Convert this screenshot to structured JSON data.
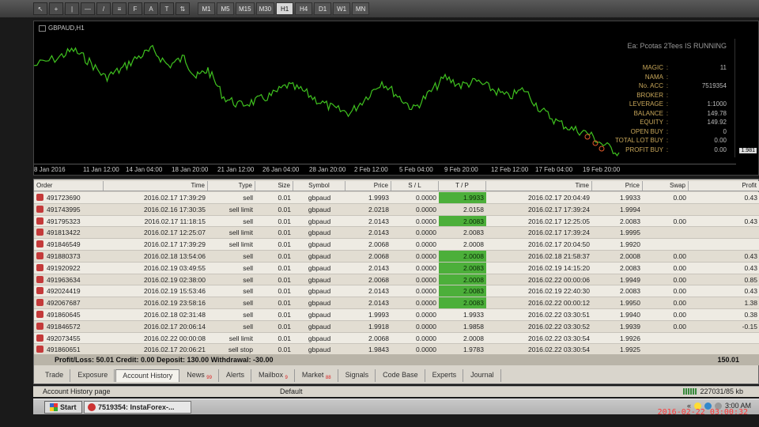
{
  "toolbar": {
    "timeframes": [
      "M1",
      "M5",
      "M15",
      "M30",
      "H1",
      "H4",
      "D1",
      "W1",
      "MN"
    ],
    "active_timeframe": "H1"
  },
  "chart": {
    "title": "GBPAUD,H1",
    "ea_status": "Ea: Pcotas  2Tees  IS  RUNNING",
    "info": [
      {
        "k": "MAGIC",
        "v": "11"
      },
      {
        "k": "NAMA",
        "v": ""
      },
      {
        "k": "No. ACC",
        "v": "7519354"
      },
      {
        "k": "BROKER",
        "v": ""
      },
      {
        "k": "LEVERAGE",
        "v": "1:1000"
      },
      {
        "k": "BALANCE",
        "v": "149.78"
      },
      {
        "k": "EQUITY",
        "v": "149.92"
      },
      {
        "k": "OPEN BUY",
        "v": "0"
      },
      {
        "k": "TOTAL LOT BUY",
        "v": "0.00"
      },
      {
        "k": "PROFIT BUY",
        "v": "0.00"
      }
    ],
    "price_tag": "1.981",
    "time_labels": [
      "8 Jan 2016",
      "11 Jan 12:00",
      "14 Jan 04:00",
      "18 Jan 20:00",
      "21 Jan 12:00",
      "26 Jan 04:00",
      "28 Jan 20:00",
      "2 Feb 12:00",
      "5 Feb 04:00",
      "9 Feb 20:00",
      "12 Feb 12:00",
      "17 Feb 04:00",
      "19 Feb 20:00"
    ]
  },
  "table": {
    "headers": [
      "Order",
      "Time",
      "Type",
      "Size",
      "Symbol",
      "Price",
      "S / L",
      "T / P",
      "Time",
      "Price",
      "Swap",
      "Profit"
    ],
    "rows": [
      {
        "order": "491723690",
        "time": "2016.02.17 17:39:29",
        "type": "sell",
        "size": "0.01",
        "symbol": "gbpaud",
        "price": "1.9993",
        "sl": "0.0000",
        "tp": "1.9933",
        "tp_hl": true,
        "time2": "2016.02.17 20:04:49",
        "price2": "1.9933",
        "swap": "0.00",
        "profit": "0.43"
      },
      {
        "order": "491743995",
        "time": "2016.02.16 17:30:35",
        "type": "sell limit",
        "size": "0.01",
        "symbol": "gbpaud",
        "price": "2.0218",
        "sl": "0.0000",
        "tp": "2.0158",
        "tp_hl": false,
        "time2": "2016.02.17 17:39:24",
        "price2": "1.9994",
        "swap": "",
        "profit": ""
      },
      {
        "order": "491795323",
        "time": "2016.02.17 11:18:15",
        "type": "sell",
        "size": "0.01",
        "symbol": "gbpaud",
        "price": "2.0143",
        "sl": "0.0000",
        "tp": "2.0083",
        "tp_hl": true,
        "time2": "2016.02.17 12:25:05",
        "price2": "2.0083",
        "swap": "0.00",
        "profit": "0.43"
      },
      {
        "order": "491813422",
        "time": "2016.02.17 12:25:07",
        "type": "sell limit",
        "size": "0.01",
        "symbol": "gbpaud",
        "price": "2.0143",
        "sl": "0.0000",
        "tp": "2.0083",
        "tp_hl": false,
        "time2": "2016.02.17 17:39:24",
        "price2": "1.9995",
        "swap": "",
        "profit": ""
      },
      {
        "order": "491846549",
        "time": "2016.02.17 17:39:29",
        "type": "sell limit",
        "size": "0.01",
        "symbol": "gbpaud",
        "price": "2.0068",
        "sl": "0.0000",
        "tp": "2.0008",
        "tp_hl": false,
        "time2": "2016.02.17 20:04:50",
        "price2": "1.9920",
        "swap": "",
        "profit": ""
      },
      {
        "order": "491880373",
        "time": "2016.02.18 13:54:06",
        "type": "sell",
        "size": "0.01",
        "symbol": "gbpaud",
        "price": "2.0068",
        "sl": "0.0000",
        "tp": "2.0008",
        "tp_hl": true,
        "time2": "2016.02.18 21:58:37",
        "price2": "2.0008",
        "swap": "0.00",
        "profit": "0.43"
      },
      {
        "order": "491920922",
        "time": "2016.02.19 03:49:55",
        "type": "sell",
        "size": "0.01",
        "symbol": "gbpaud",
        "price": "2.0143",
        "sl": "0.0000",
        "tp": "2.0083",
        "tp_hl": true,
        "time2": "2016.02.19 14:15:20",
        "price2": "2.0083",
        "swap": "0.00",
        "profit": "0.43"
      },
      {
        "order": "491963634",
        "time": "2016.02.19 02:38:00",
        "type": "sell",
        "size": "0.01",
        "symbol": "gbpaud",
        "price": "2.0068",
        "sl": "0.0000",
        "tp": "2.0008",
        "tp_hl": true,
        "time2": "2016.02.22 00:00:06",
        "price2": "1.9949",
        "swap": "0.00",
        "profit": "0.85"
      },
      {
        "order": "492024419",
        "time": "2016.02.19 15:53:46",
        "type": "sell",
        "size": "0.01",
        "symbol": "gbpaud",
        "price": "2.0143",
        "sl": "0.0000",
        "tp": "2.0083",
        "tp_hl": true,
        "time2": "2016.02.19 22:40:30",
        "price2": "2.0083",
        "swap": "0.00",
        "profit": "0.43"
      },
      {
        "order": "492067687",
        "time": "2016.02.19 23:58:16",
        "type": "sell",
        "size": "0.01",
        "symbol": "gbpaud",
        "price": "2.0143",
        "sl": "0.0000",
        "tp": "2.0083",
        "tp_hl": true,
        "time2": "2016.02.22 00:00:12",
        "price2": "1.9950",
        "swap": "0.00",
        "profit": "1.38"
      },
      {
        "order": "491860645",
        "time": "2016.02.18 02:31:48",
        "type": "sell",
        "size": "0.01",
        "symbol": "gbpaud",
        "price": "1.9993",
        "sl": "0.0000",
        "tp": "1.9933",
        "tp_hl": false,
        "time2": "2016.02.22 03:30:51",
        "price2": "1.9940",
        "swap": "0.00",
        "profit": "0.38"
      },
      {
        "order": "491846572",
        "time": "2016.02.17 20:06:14",
        "type": "sell",
        "size": "0.01",
        "symbol": "gbpaud",
        "price": "1.9918",
        "sl": "0.0000",
        "tp": "1.9858",
        "tp_hl": false,
        "time2": "2016.02.22 03:30:52",
        "price2": "1.9939",
        "swap": "0.00",
        "profit": "-0.15"
      },
      {
        "order": "492073455",
        "time": "2016.02.22 00:00:08",
        "type": "sell limit",
        "size": "0.01",
        "symbol": "gbpaud",
        "price": "2.0068",
        "sl": "0.0000",
        "tp": "2.0008",
        "tp_hl": false,
        "time2": "2016.02.22 03:30:54",
        "price2": "1.9926",
        "swap": "",
        "profit": ""
      },
      {
        "order": "491860651",
        "time": "2016.02.17 20:06:21",
        "type": "sell stop",
        "size": "0.01",
        "symbol": "gbpaud",
        "price": "1.9843",
        "sl": "0.0000",
        "tp": "1.9783",
        "tp_hl": false,
        "time2": "2016.02.22 03:30:54",
        "price2": "1.9925",
        "swap": "",
        "profit": ""
      }
    ]
  },
  "summary": {
    "text": "Profit/Loss: 50.01  Credit: 0.00  Deposit: 130.00  Withdrawal: -30.00",
    "total": "150.01"
  },
  "tabs": [
    {
      "label": "Trade",
      "badge": ""
    },
    {
      "label": "Exposure",
      "badge": ""
    },
    {
      "label": "Account History",
      "badge": "",
      "active": true
    },
    {
      "label": "News",
      "badge": "99"
    },
    {
      "label": "Alerts",
      "badge": ""
    },
    {
      "label": "Mailbox",
      "badge": "9"
    },
    {
      "label": "Market",
      "badge": "88"
    },
    {
      "label": "Signals",
      "badge": ""
    },
    {
      "label": "Code Base",
      "badge": ""
    },
    {
      "label": "Experts",
      "badge": ""
    },
    {
      "label": "Journal",
      "badge": ""
    }
  ],
  "statusbar": {
    "left": "Account History page",
    "mid": "Default",
    "right": "227031/85 kb"
  },
  "taskbar": {
    "start": "Start",
    "task": "7519354: InstaForex-...",
    "clock": "3:00 AM"
  },
  "photo_timestamp": "2016-02-22 03:00:32",
  "colors": {
    "chart_line": "#3fc21f",
    "tp_highlight": "#4caf3a",
    "info_text": "#c8a75a",
    "timestamp": "#ff3a3a"
  }
}
